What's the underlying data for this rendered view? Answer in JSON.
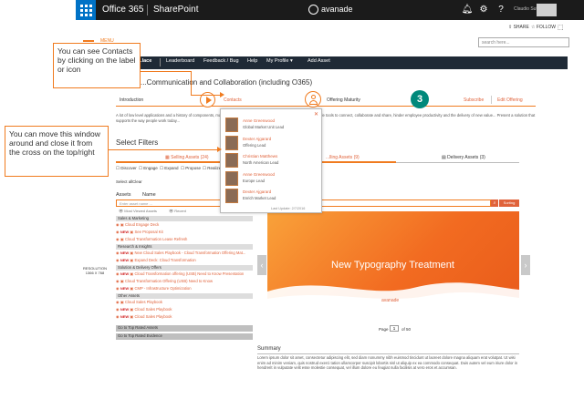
{
  "suite": {
    "office": "Office 365",
    "sharepoint": "SharePoint",
    "brand": "avanade",
    "user": "Claudio Sutdano (c)"
  },
  "suite2": {
    "share": "SHARE",
    "follow": "FOLLOW"
  },
  "menu_label": "MENU",
  "search_placeholder": "search here...",
  "brandbar_label": "...lace",
  "nav": [
    "Leaderboard",
    "Feedback / Bug",
    "Help",
    "My Profile ▾",
    "Add Asset"
  ],
  "page_title": "...Communication and Collaboration (including O365)",
  "wizard": {
    "intro": "Introduction",
    "contacts": "Contacts",
    "maturity": "Offering Maturity",
    "step_number": "3",
    "subscribe": "Subscribe",
    "edit": "Edit Offering"
  },
  "intro_text": "A lot of low level applications and a history of components, making them harder to maintain. Employees tend to use multiple tools to connect, collaborate and share, hinder employee productivity and the delivery of new value... Present a solution that supports the way people work today...",
  "callouts": {
    "contacts": "You can see Contacts by clicking on the label or icon",
    "window": "You can move this window around and close it from the cross on the top/right"
  },
  "popup": {
    "close": "✕",
    "contacts": [
      {
        "name": "Anne Greenwood",
        "role": "Global Market Unit Lead"
      },
      {
        "name": "Dexter Ajgarard",
        "role": "Offering Lead"
      },
      {
        "name": "Christian Matthews",
        "role": "North American Lead"
      },
      {
        "name": "Anne Greenwood",
        "role": "Europe Lead"
      },
      {
        "name": "Dexter Ajgarard",
        "role": "Enrich Market Lead"
      }
    ],
    "footer": "Last Update: 2/7/2016"
  },
  "filters": {
    "title": "Select Filters",
    "tab_selling": "Selling Assets (24)",
    "tab_selling_right": "...lling Assets (9)",
    "tab_delivery": "Delivery Assets (3)",
    "stages": [
      "Discover",
      "Engage",
      "Expand",
      "Propose",
      "Realize"
    ],
    "select_all": "Select all",
    "clear": "Clear"
  },
  "assets": {
    "col_assets": "Assets",
    "col_name": "Name",
    "search_placeholder": "Enter asset name ...",
    "sort_label": "Sorting",
    "views_label": "Most Viewed Assets",
    "recent_label": "Recent",
    "groups": [
      {
        "title": "Sales & Marketing",
        "rows": [
          {
            "new": "",
            "name": "Cloud Engage Deck"
          },
          {
            "new": "NEW",
            "name": "See Proposal Kit"
          },
          {
            "new": "",
            "name": "Cloud Transformation Lease Refresh"
          }
        ]
      },
      {
        "title": "Research & Insights",
        "rows": [
          {
            "new": "NEW",
            "name": "New Cloud Sales Playbook - Cloud Transformation Offering Mat..."
          },
          {
            "new": "NEW",
            "name": "Expand Deck: Cloud Transformation"
          }
        ]
      },
      {
        "title": "Solution & Delivery Offers",
        "rows": [
          {
            "new": "NEW",
            "name": "Cloud Transformation offering (USB) Need to Know Presentation"
          },
          {
            "new": "",
            "name": "Cloud Transformation Offering (USB) Need to Know"
          },
          {
            "new": "NEW",
            "name": "CMP - Infrastructure Optimization"
          }
        ]
      },
      {
        "title": "Other Assets",
        "rows": [
          {
            "new": "",
            "name": "Cloud Sales Playbook"
          },
          {
            "new": "NEW",
            "name": "Cloud Sales Playbook"
          },
          {
            "new": "NEW",
            "name": "Cloud Sales Playbook"
          }
        ]
      }
    ],
    "goto_rated": "Go to Top Rated Assets",
    "goto_evidence": "Go to Top Rated Evidence"
  },
  "preview": {
    "title": "New Typography Treatment",
    "brand": "avanade",
    "page_label": "Page",
    "page_value": "1",
    "page_of": "of 50"
  },
  "summary": {
    "title": "Summary",
    "text": "Lorem ipsum dolor sit amet, consectetur adipiscing elit, sed diam nonummy nibh euismod tincidunt ut laoreet dolore magna aliquam erat volutpat. Ut wisi enim ad minim veniam, quis nostrud exerci tation ullamcorper suscipit lobortis nisl ut aliquip ex ea commodo consequat. Duis autem vel eum iriure dolor in hendrerit in vulputate velit esse molestie consequat, vel illum dolore eu feugiat nulla facilisis at vero eros et accumsan."
  },
  "resolution": "RESOLUTION\n1366 X 768"
}
